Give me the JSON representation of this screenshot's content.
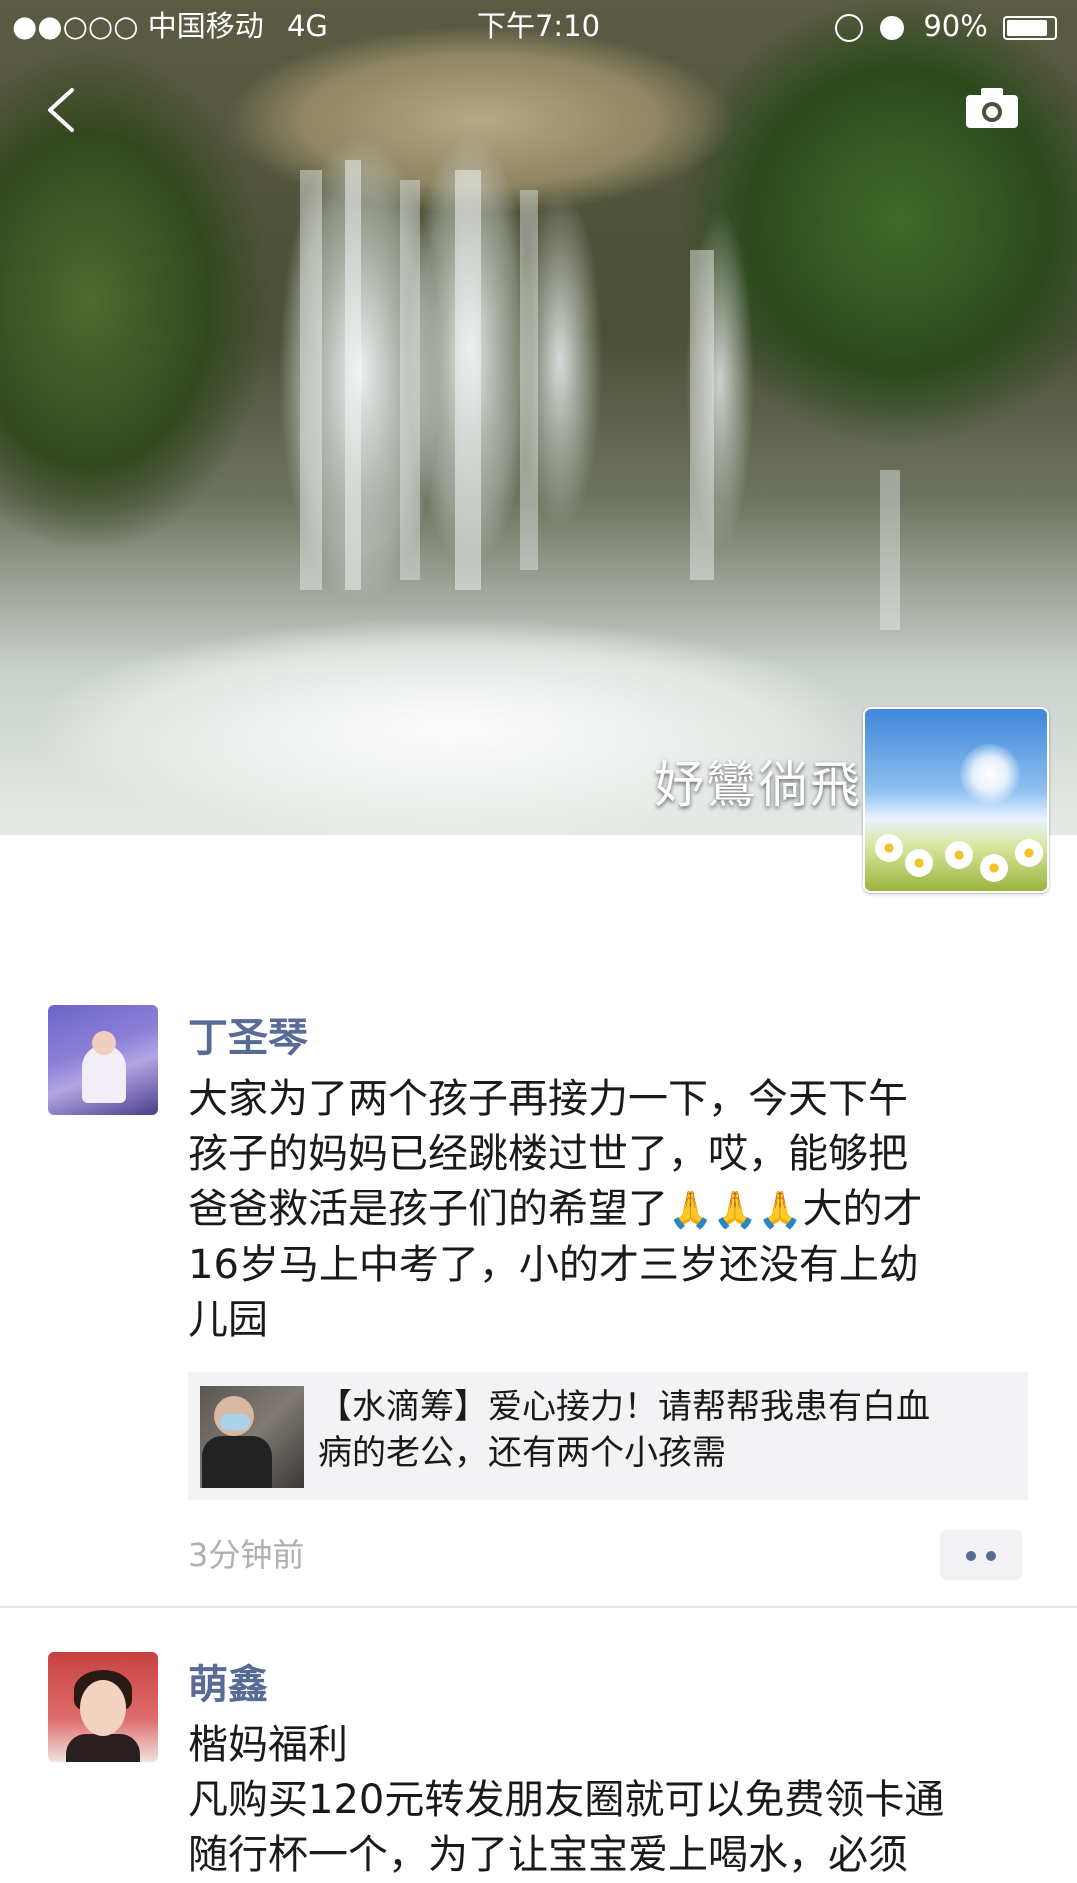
{
  "status_bar": {
    "signal": "●●○○○",
    "carrier": "中国移动",
    "network": "4G",
    "time": "下午7:10",
    "icons": [
      "lock-rotation-icon",
      "alarm-icon"
    ],
    "battery": "90%"
  },
  "cover": {
    "user_name": "妤鸞徜飛",
    "back_icon": "chevron-left-icon",
    "camera_icon": "camera-icon"
  },
  "posts": [
    {
      "name": "丁圣琴",
      "text_parts": [
        "大家为了两个孩子再接力一下，今天下午",
        "孩子的妈妈已经跳楼过世了，哎，能够把",
        "爸爸救活是孩子们的希望了",
        "🙏🙏🙏",
        "大的才",
        "16岁马上中考了，小的才三岁还没有上幼",
        "儿园"
      ],
      "link": {
        "title_line1": "【水滴筹】爱心接力！请帮帮我患有白血",
        "title_line2": "病的老公，还有两个小孩需"
      },
      "time": "3分钟前"
    },
    {
      "name": "萌鑫",
      "lines": [
        "楷妈福利",
        "凡购买120元转发朋友圈就可以免费领卡通",
        "随行杯一个，为了让宝宝爱上喝水，必须"
      ]
    }
  ]
}
